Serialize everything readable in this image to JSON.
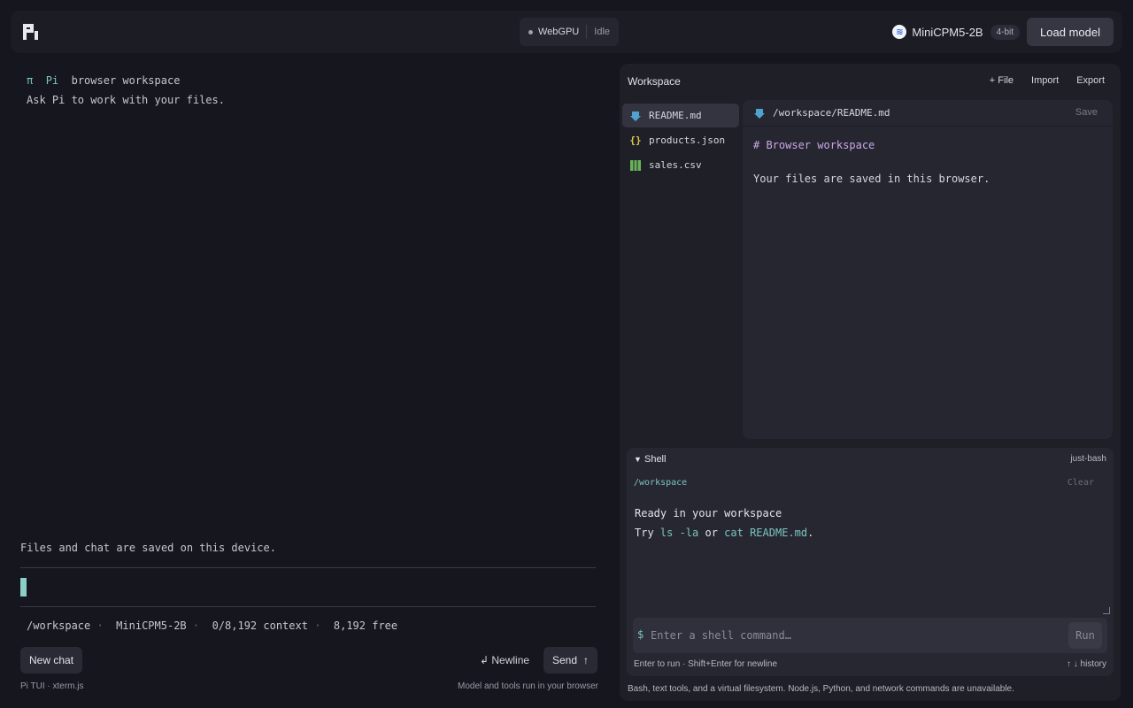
{
  "header": {
    "backend": "WebGPU",
    "state": "Idle",
    "model_name": "MiniCPM5-2B",
    "quantization": "4-bit",
    "load_button": "Load model"
  },
  "terminal": {
    "banner_symbol": "π",
    "banner_name": "Pi",
    "banner_rest": "browser workspace",
    "intro": "Ask Pi to work with your files.",
    "saved_note": "Files and chat are saved on this device.",
    "status": {
      "cwd": "/workspace",
      "model": "MiniCPM5-2B",
      "context": "0/8,192 context",
      "free": "8,192 free",
      "separator": "·"
    },
    "new_chat": "New chat",
    "newline": "↲ Newline",
    "send": "Send",
    "send_glyph": "↑",
    "footer_left": "Pi TUI · xterm.js",
    "footer_right": "Model and tools run in your browser"
  },
  "workspace": {
    "title": "Workspace",
    "actions": [
      "+ File",
      "Import",
      "Export"
    ],
    "files": [
      {
        "name": "README.md",
        "icon": "markdown-icon",
        "color": "#4fa3d1"
      },
      {
        "name": "products.json",
        "icon": "json-icon",
        "color": "#e2c84a"
      },
      {
        "name": "sales.csv",
        "icon": "table-icon",
        "color": "#6bb35a"
      }
    ],
    "editor": {
      "path": "/workspace/README.md",
      "save": "Save",
      "heading": "# Browser workspace",
      "body": "Your files are saved in this browser."
    },
    "shell": {
      "title": "Shell",
      "tag": "just-bash",
      "cwd": "/workspace",
      "clear": "Clear",
      "output_line1": "Ready in your workspace",
      "output_try": "Try ",
      "output_cmd1": "ls -la",
      "output_or": " or ",
      "output_cmd2": "cat README.md",
      "output_end": ".",
      "prompt": "$",
      "placeholder": "Enter a shell command…",
      "run": "Run",
      "hint": "Enter to run · Shift+Enter for newline",
      "history": "↑ ↓  history"
    },
    "footer": "Bash, text tools, and a virtual filesystem. Node.js, Python, and network commands are unavailable."
  }
}
